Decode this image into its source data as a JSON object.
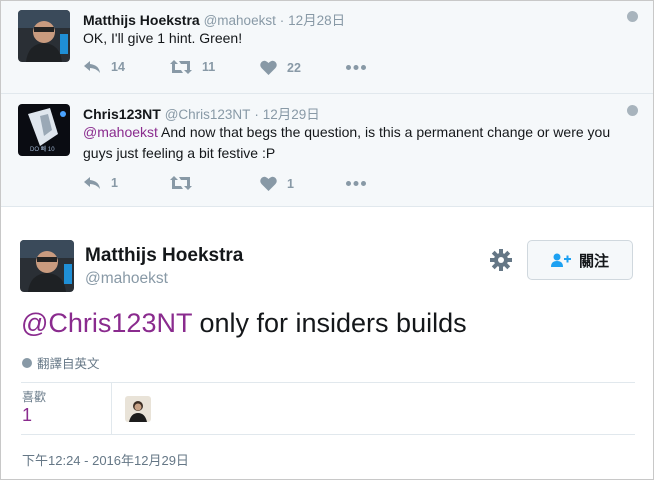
{
  "replies": [
    {
      "name": "Matthijs Hoekstra",
      "handle": "@mahoekst",
      "sep": "·",
      "time": "12月28日",
      "text": "OK,  I'll give 1 hint. Green!",
      "reply_count": "14",
      "retweet_count": "11",
      "like_count": "22"
    },
    {
      "name": "Chris123NT",
      "handle": "@Chris123NT",
      "sep": "·",
      "time": "12月29日",
      "mention": "@mahoekst",
      "text": " And now that begs the question, is this a permanent change or were you guys just feeling a bit festive :P",
      "reply_count": "1",
      "retweet_count": "",
      "like_count": "1",
      "avatar_caption": "DO 빼 10"
    }
  ],
  "tweet": {
    "name": "Matthijs Hoekstra",
    "handle": "@mahoekst",
    "follow_label": "關注",
    "mention": "@Chris123NT",
    "text": " only for insiders builds",
    "translate_label": "翻譯自英文",
    "likes_label": "喜歡",
    "likes_count": "1",
    "timestamp": "下午12:24 - 2016年12月29日"
  },
  "icons": {
    "reply": "reply-icon",
    "retweet": "retweet-icon",
    "like": "heart-icon",
    "more": "more-icon",
    "globe": "globe-icon",
    "gear": "gear-icon",
    "follow": "add-user-icon"
  },
  "colors": {
    "mention": "#8a2b8e",
    "muted": "#8899a6",
    "background_replies": "#f5f8fa"
  }
}
